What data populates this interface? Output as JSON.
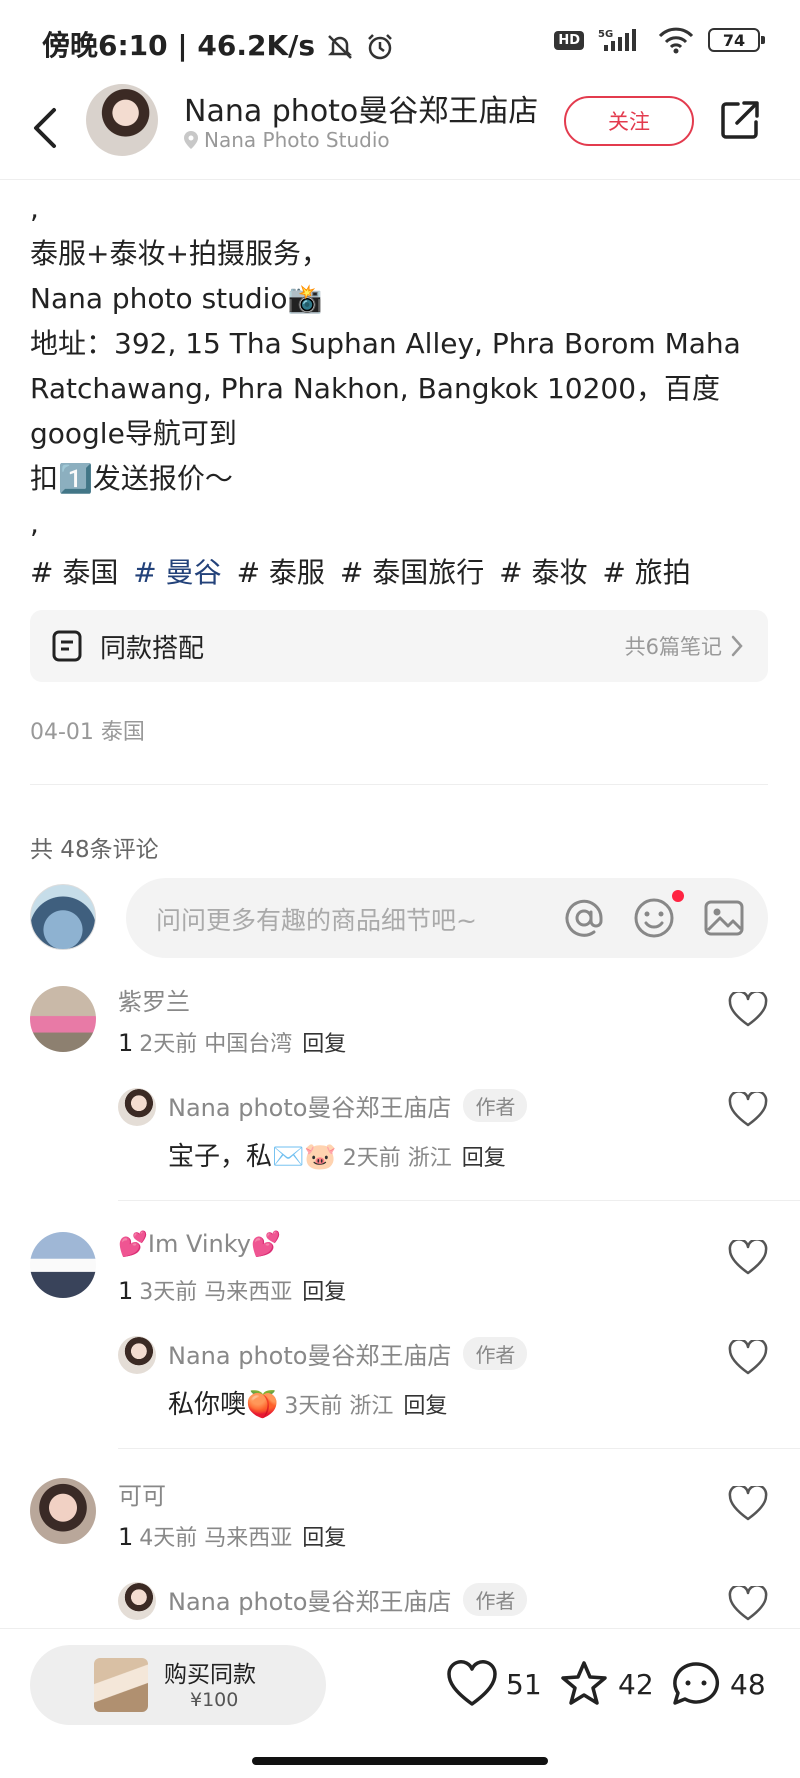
{
  "status_bar": {
    "time_speed": "傍晚6:10 | 46.2K/s",
    "hd": "HD",
    "network": "5G",
    "battery": "74"
  },
  "header": {
    "title": "Nana photo曼谷郑王庙店",
    "location": "Nana Photo Studio",
    "follow_label": "关注"
  },
  "post": {
    "lines": [
      ",",
      "泰服+泰妆+拍摄服务，",
      "Nana photo studio📸",
      "地址：392, 15 Tha Suphan Alley, Phra Borom Maha",
      "Ratchawang, Phra Nakhon, Bangkok 10200，百度",
      "google导航可到",
      "扣1️⃣发送报价～",
      ","
    ],
    "tags": [
      "# 泰国",
      "# 曼谷",
      "# 泰服",
      "# 泰国旅行",
      "# 泰妆",
      "# 旅拍"
    ],
    "outfit_label": "同款搭配",
    "outfit_count": "共6篇笔记",
    "date_location": "04-01 泰国"
  },
  "comments_section": {
    "count_label": "共 48条评论",
    "input_placeholder": "问问更多有趣的商品细节吧~"
  },
  "comments": [
    {
      "user": "紫罗兰",
      "text": "1",
      "meta": "2天前  中国台湾",
      "reply_label": "回复",
      "reply": {
        "user": "Nana photo曼谷郑王庙店",
        "badge": "作者",
        "text": "宝子，私✉️🐷",
        "meta": "2天前  浙江",
        "reply_label": "回复"
      }
    },
    {
      "user": "💕Im Vinky💕",
      "text": "1",
      "meta": "3天前  马来西亚",
      "reply_label": "回复",
      "reply": {
        "user": "Nana photo曼谷郑王庙店",
        "badge": "作者",
        "text": "私你噢🍑",
        "meta": "3天前  浙江",
        "reply_label": "回复"
      }
    },
    {
      "user": "可可",
      "text": "1",
      "meta": "4天前  马来西亚",
      "reply_label": "回复",
      "reply": {
        "user": "Nana photo曼谷郑王庙店",
        "badge": "作者"
      }
    }
  ],
  "bottom_bar": {
    "buy_label": "购买同款",
    "buy_price": "¥100",
    "likes": "51",
    "favorites": "42",
    "comments": "48"
  },
  "colors": {
    "accent": "#e33b4e",
    "tag_highlight": "#23427a",
    "notification_dot": "#ff2442"
  }
}
